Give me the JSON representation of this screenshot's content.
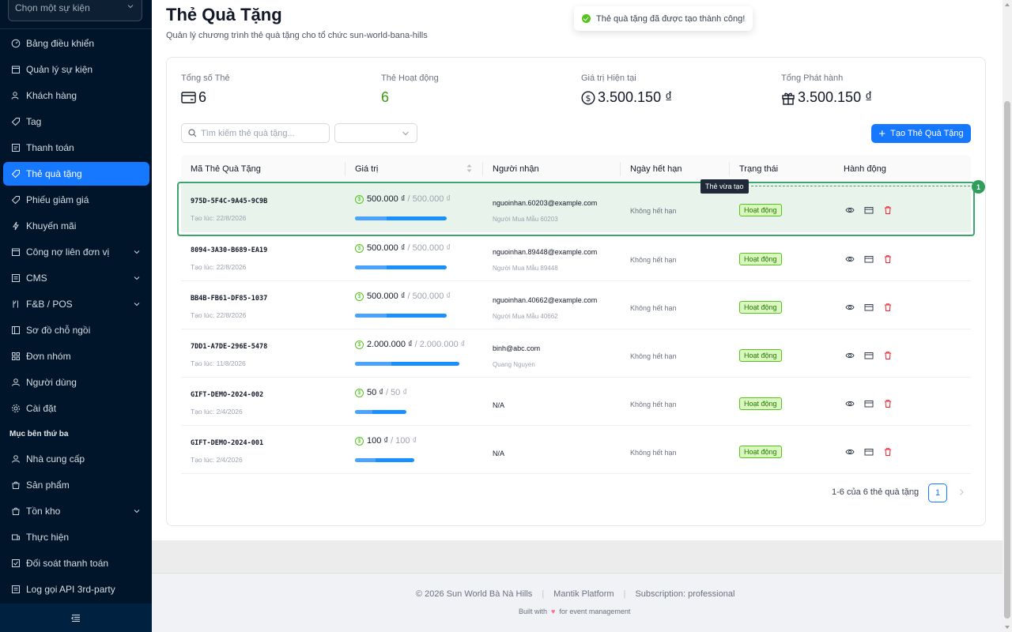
{
  "sidebar": {
    "event_select_placeholder": "Chọn một sự kiện",
    "items": [
      {
        "label": "Bảng điều khiển",
        "icon": "dashboard-icon"
      },
      {
        "label": "Quản lý sự kiện",
        "icon": "calendar-icon"
      },
      {
        "label": "Khách hàng",
        "icon": "users-icon"
      },
      {
        "label": "Tag",
        "icon": "tag-icon"
      },
      {
        "label": "Thanh toán",
        "icon": "payment-icon"
      },
      {
        "label": "Thẻ quà tặng",
        "icon": "gift-card-icon",
        "active": true
      },
      {
        "label": "Phiếu giảm giá",
        "icon": "coupon-icon"
      },
      {
        "label": "Khuyến mãi",
        "icon": "promotion-icon"
      },
      {
        "label": "Công nợ liên đơn vị",
        "icon": "debt-icon",
        "expandable": true
      },
      {
        "label": "CMS",
        "icon": "cms-icon",
        "expandable": true
      },
      {
        "label": "F&B / POS",
        "icon": "pos-icon",
        "expandable": true
      },
      {
        "label": "Sơ đồ chỗ ngồi",
        "icon": "seat-map-icon"
      },
      {
        "label": "Đơn nhóm",
        "icon": "group-order-icon"
      },
      {
        "label": "Người dùng",
        "icon": "user-icon"
      },
      {
        "label": "Cài đặt",
        "icon": "settings-icon"
      }
    ],
    "group_label": "Mục bên thứ ba",
    "third_party_items": [
      {
        "label": "Nhà cung cấp",
        "icon": "supplier-icon"
      },
      {
        "label": "Sản phẩm",
        "icon": "product-icon"
      },
      {
        "label": "Tồn kho",
        "icon": "inventory-icon",
        "expandable": true
      },
      {
        "label": "Thực hiện",
        "icon": "fulfillment-icon"
      },
      {
        "label": "Đối soát thanh toán",
        "icon": "reconciliation-icon"
      },
      {
        "label": "Log gọi API 3rd-party",
        "icon": "api-log-icon"
      }
    ]
  },
  "header": {
    "title": "Thẻ Quà Tặng",
    "subtitle": "Quản lý chương trình thẻ quà tặng cho tổ chức sun-world-bana-hills"
  },
  "toast": {
    "message": "Thẻ quà tặng đã được tạo thành công!"
  },
  "stats": [
    {
      "label": "Tổng số Thẻ",
      "value": "6",
      "icon": "card-icon"
    },
    {
      "label": "Thẻ Hoạt động",
      "value": "6"
    },
    {
      "label": "Giá trị Hiện tại",
      "value": "3.500.150 ₫",
      "icon": "dollar-circle-icon"
    },
    {
      "label": "Tổng Phát hành",
      "value": "3.500.150 ₫",
      "icon": "gift-icon"
    }
  ],
  "toolbar": {
    "search_placeholder": "Tìm kiếm thẻ quà tặng...",
    "create_label": "Tạo Thẻ Quà Tặng"
  },
  "table": {
    "columns": [
      "Mã Thẻ Quà Tặng",
      "Giá trị",
      "Người nhận",
      "Ngày hết hạn",
      "Trạng thái",
      "Hành động"
    ],
    "rows": [
      {
        "code": "975D-5F4C-9A45-9C9B",
        "created": "Tạo lúc: 22/8/2026",
        "balance": "500.000 ₫",
        "total": "/ 500.000 ₫",
        "remaining_fraction": 1.0,
        "email": "nguoinhan.60203@example.com",
        "buyer": "Người Mua Mẫu 60203",
        "expiry": "Không hết hạn",
        "status": "Hoạt động"
      },
      {
        "code": "8094-3A30-B689-EA19",
        "created": "Tạo lúc: 22/8/2026",
        "balance": "500.000 ₫",
        "total": "/ 500.000 ₫",
        "remaining_fraction": 1.0,
        "email": "nguoinhan.89448@example.com",
        "buyer": "Người Mua Mẫu 89448",
        "expiry": "Không hết hạn",
        "status": "Hoạt động"
      },
      {
        "code": "BB4B-FB61-DF85-1037",
        "created": "Tạo lúc: 22/8/2026",
        "balance": "500.000 ₫",
        "total": "/ 500.000 ₫",
        "remaining_fraction": 1.0,
        "email": "nguoinhan.40662@example.com",
        "buyer": "Người Mua Mẫu 40662",
        "expiry": "Không hết hạn",
        "status": "Hoạt động"
      },
      {
        "code": "7DD1-A7DE-296E-5478",
        "created": "Tạo lúc: 11/8/2026",
        "balance": "2.000.000 ₫",
        "total": "/ 2.000.000 ₫",
        "remaining_fraction": 1.0,
        "email": "binh@abc.com",
        "buyer": "Quang Nguyen",
        "expiry": "Không hết hạn",
        "status": "Hoạt động"
      },
      {
        "code": "GIFT-DEMO-2024-002",
        "created": "Tạo lúc: 2/4/2026",
        "balance": "50 ₫",
        "total": "/ 50 ₫",
        "remaining_fraction": 1.0,
        "recipient": "N/A",
        "expiry": "Không hết hạn",
        "status": "Hoạt động"
      },
      {
        "code": "GIFT-DEMO-2024-001",
        "created": "Tạo lúc: 2/4/2026",
        "balance": "100 ₫",
        "total": "/ 100 ₫",
        "remaining_fraction": 1.0,
        "recipient": "N/A",
        "expiry": "Không hết hạn",
        "status": "Hoạt động"
      }
    ]
  },
  "highlight": {
    "tooltip": "Thẻ vừa tạo",
    "marker": "1",
    "color": "#3aa66b"
  },
  "pagination": {
    "summary": "1-6 của 6 thẻ quà tặng",
    "current_page": "1"
  },
  "footer": {
    "copyright": "© 2026 Sun World Bà Nà Hills",
    "platform": "Mantik Platform",
    "subscription": "Subscription: professional",
    "built_prefix": "Built with",
    "built_suffix": "for event management"
  },
  "colors": {
    "sidebar_bg": "#001529",
    "primary": "#1677ff",
    "success": "#52c41a",
    "danger": "#f5222d"
  }
}
